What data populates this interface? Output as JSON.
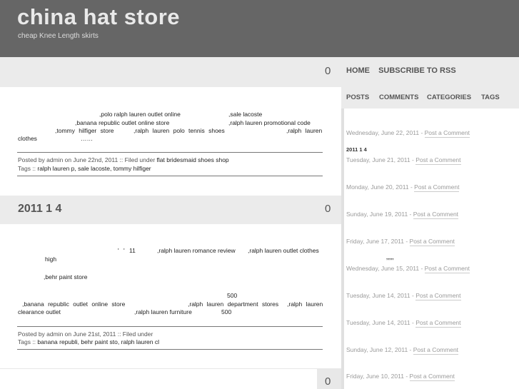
{
  "header": {
    "title": "china hat store",
    "tagline": "cheap Knee Length skirts"
  },
  "top_count": "0",
  "nav": [
    "HOME",
    "SUBSCRIBE TO RSS"
  ],
  "tabs": [
    "POSTS",
    "COMMENTS",
    "CATEGORIES",
    "TAGS"
  ],
  "sidebar": {
    "entries": [
      {
        "date": "Wednesday, June 22, 2011",
        "link": "Post a Comment"
      },
      {
        "date": "Tuesday, June 21, 2011",
        "link": "Post a Comment"
      },
      {
        "date": "Monday, June 20, 2011",
        "link": "Post a Comment"
      },
      {
        "date": "Sunday, June 19, 2011",
        "link": "Post a Comment"
      },
      {
        "date": "Friday, June 17, 2011",
        "link": "Post a Comment"
      },
      {
        "date": "Wednesday, June 15, 2011",
        "link": "Post a Comment"
      },
      {
        "date": "Tuesday, June 14, 2011",
        "link": "Post a Comment"
      },
      {
        "date": "Tuesday, June 14, 2011",
        "link": "Post a Comment"
      },
      {
        "date": "Sunday, June 12, 2011",
        "link": "Post a Comment"
      },
      {
        "date": "Friday, June 10, 2011",
        "link": "Post a Comment"
      }
    ],
    "note_1": "2011 1 4",
    "note_2": ",,,,,"
  },
  "post1": {
    "l1a": ",polo ralph lauren outlet online",
    "l1b": ",sale lacoste",
    "l2a": ",banana republic outlet online store",
    "l2b": ",ralph lauren promotional code",
    "l3a": ",tommy hilfiger store",
    "l3b": ",ralph lauren polo tennis shoes",
    "l3c": ",ralph lauren",
    "l4a": "clothes",
    "l4b": "……",
    "meta_prefix": "Posted by admin on June 22nd, 2011 :: Filed under",
    "meta_category": "flat bridesmaid shoes shop",
    "tags_prefix": "Tags ::",
    "tags": "ralph lauren p, sale lacoste, tommy hilfiger"
  },
  "post2": {
    "title": "2011 1 4",
    "count": "0",
    "l1a": "' ' 11",
    "l1b": ",ralph lauren romance review",
    "l1c": ",ralph lauren outlet clothes",
    "l2": "high",
    "l3": ",behr paint store",
    "l4": "500",
    "l5a": ",banana republic outlet online store",
    "l5b": ",ralph lauren department stores",
    "l5c": ",ralph lauren",
    "l6a": "clearance outlet",
    "l6b": ",ralph lauren furniture",
    "l6c": "500",
    "meta_prefix": "Posted by admin on June 21st, 2011 :: Filed under",
    "tags_prefix": "Tags ::",
    "tags": "banana republi, behr paint sto, ralph lauren cl"
  },
  "post3": {
    "count": "0"
  }
}
